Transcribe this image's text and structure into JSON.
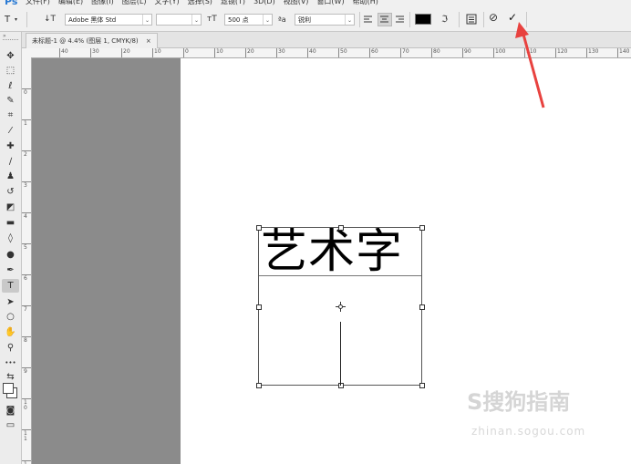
{
  "app": {
    "logo": "Ps"
  },
  "menu": [
    "文件(F)",
    "编辑(E)",
    "图像(I)",
    "图层(L)",
    "文字(Y)",
    "选择(S)",
    "滤镜(T)",
    "3D(D)",
    "视图(V)",
    "窗口(W)",
    "帮助(H)"
  ],
  "options": {
    "tool_glyph": "T",
    "orientation_glyph": "↓T",
    "font_family": "Adobe 黑体 Std",
    "font_style": "",
    "size_glyph": "ᴛT",
    "font_size": "500 点",
    "aa_glyph": "ªa",
    "antialias": "锐利",
    "text_color": "#000000",
    "commit_glyph": "✓",
    "cancel_glyph": "⊘"
  },
  "document": {
    "tab_title": "未标题-1 @ 4.4% (图层 1, CMYK/8)",
    "close_glyph": "×"
  },
  "canvas": {
    "text": "艺术字"
  },
  "ruler": {
    "h": [
      "40",
      "30",
      "20",
      "10",
      "0",
      "10",
      "20",
      "30",
      "40",
      "50",
      "60",
      "70",
      "80",
      "90",
      "100",
      "110",
      "120",
      "130",
      "140"
    ],
    "v": [
      "0",
      "1",
      "2",
      "3",
      "4",
      "5",
      "6",
      "7",
      "8",
      "9",
      "10",
      "11",
      "12"
    ]
  },
  "tools": [
    {
      "name": "move-tool",
      "glyph": "✥"
    },
    {
      "name": "marquee-tool",
      "glyph": "⬚"
    },
    {
      "name": "lasso-tool",
      "glyph": "ℓ"
    },
    {
      "name": "quick-select-tool",
      "glyph": "✎"
    },
    {
      "name": "crop-tool",
      "glyph": "⌗"
    },
    {
      "name": "eyedropper-tool",
      "glyph": "⁄"
    },
    {
      "name": "healing-brush-tool",
      "glyph": "✚"
    },
    {
      "name": "brush-tool",
      "glyph": "∕"
    },
    {
      "name": "clone-stamp-tool",
      "glyph": "♟"
    },
    {
      "name": "history-brush-tool",
      "glyph": "↺"
    },
    {
      "name": "eraser-tool",
      "glyph": "◩"
    },
    {
      "name": "gradient-tool",
      "glyph": "▬"
    },
    {
      "name": "blur-tool",
      "glyph": "◊"
    },
    {
      "name": "dodge-tool",
      "glyph": "●"
    },
    {
      "name": "pen-tool",
      "glyph": "✒"
    },
    {
      "name": "type-tool",
      "glyph": "T",
      "active": true
    },
    {
      "name": "path-select-tool",
      "glyph": "➤"
    },
    {
      "name": "ellipse-tool",
      "glyph": "○"
    },
    {
      "name": "hand-tool",
      "glyph": "✋"
    },
    {
      "name": "zoom-tool",
      "glyph": "⚲"
    },
    {
      "name": "more-tools",
      "glyph": "•••"
    },
    {
      "name": "swap-colors",
      "glyph": "⇆"
    },
    {
      "name": "color-swatches",
      "glyph": ""
    },
    {
      "name": "quick-mask",
      "glyph": "◙"
    },
    {
      "name": "screen-mode",
      "glyph": "▭"
    }
  ],
  "watermark": {
    "brand": "S搜狗指南",
    "url": "zhinan.sogou.com"
  },
  "annotation": {
    "color": "#e8423f"
  }
}
